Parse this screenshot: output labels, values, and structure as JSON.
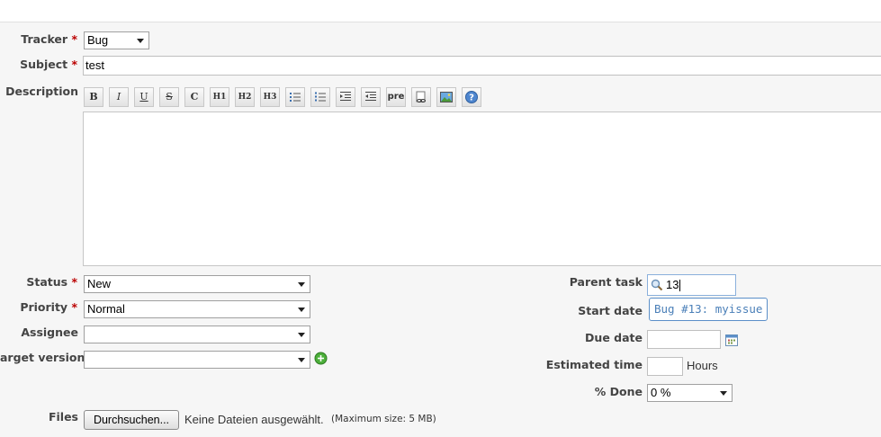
{
  "labels": {
    "tracker": "Tracker",
    "subject": "Subject",
    "description": "Description",
    "status": "Status",
    "priority": "Priority",
    "assignee": "Assignee",
    "target_version": "arget version",
    "files": "Files",
    "parent_task": "Parent task",
    "start_date": "Start date",
    "due_date": "Due date",
    "estimated_time": "Estimated time",
    "percent_done": "% Done"
  },
  "required_marker": "*",
  "fields": {
    "tracker": "Bug",
    "subject": "test",
    "status": "New",
    "priority": "Normal",
    "assignee": "",
    "target_version": "",
    "parent_task": "13",
    "due_date": "",
    "estimated_time": "",
    "percent_done": "0 %"
  },
  "toolbar": {
    "bold": "B",
    "italic": "I",
    "underline": "U",
    "strike": "S",
    "code": "C",
    "h1": "H1",
    "h2": "H2",
    "h3": "H3",
    "pre": "pre"
  },
  "autocomplete_item": "Bug #13: myissue",
  "hours_unit": "Hours",
  "files": {
    "browse_button": "Durchsuchen...",
    "no_file": "Keine Dateien ausgewählt.",
    "max_size": "(Maximum size: 5 MB)"
  },
  "colors": {
    "required": "#bb0000",
    "link_blue": "#4a7fb8",
    "add_green": "#3c9c35"
  }
}
